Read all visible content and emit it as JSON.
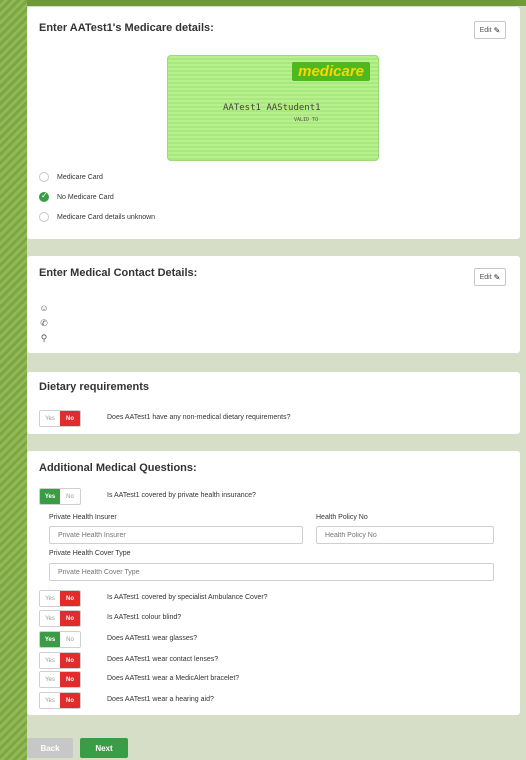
{
  "medicare": {
    "title": "Enter AATest1's Medicare details:",
    "edit_label": "Edit",
    "card": {
      "logo": "medicare",
      "name": "AATest1 AAStudent1",
      "valid": "VALID TO"
    },
    "options": [
      {
        "label": "Medicare Card",
        "selected": false
      },
      {
        "label": "No Medicare Card",
        "selected": true
      },
      {
        "label": "Medicare Card details unknown",
        "selected": false
      }
    ]
  },
  "contact": {
    "title": "Enter Medical Contact Details:",
    "edit_label": "Edit",
    "icons": [
      "person-icon",
      "phone-icon",
      "location-pin-icon"
    ]
  },
  "dietary": {
    "title": "Dietary requirements",
    "question": "Does AATest1 have any non-medical dietary requirements?",
    "answer": "No"
  },
  "additional": {
    "title": "Additional Medical Questions:",
    "yes_label": "Yes",
    "no_label": "No",
    "insurance_question": "Is AATest1 covered by private health insurance?",
    "insurance_answer": "Yes",
    "fields": {
      "insurer_label": "Private Health Insurer",
      "insurer_placeholder": "Private Health Insurer",
      "policy_label": "Health Policy No",
      "policy_placeholder": "Health Policy No",
      "cover_label": "Private Health Cover Type",
      "cover_placeholder": "Private Health Cover Type"
    },
    "questions": [
      {
        "text": "Is AATest1 covered by specialist Ambulance Cover?",
        "answer": "No"
      },
      {
        "text": "Is AATest1 colour blind?",
        "answer": "No"
      },
      {
        "text": "Does AATest1 wear glasses?",
        "answer": "Yes"
      },
      {
        "text": "Does AATest1 wear contact lenses?",
        "answer": "No"
      },
      {
        "text": "Does AATest1 wear a MedicAlert bracelet?",
        "answer": "No"
      },
      {
        "text": "Does AATest1 wear a hearing aid?",
        "answer": "No"
      }
    ]
  },
  "footer": {
    "back_label": "Back",
    "next_label": "Next"
  },
  "colors": {
    "accent_green": "#3a9d46",
    "no_red": "#e32b2b"
  }
}
